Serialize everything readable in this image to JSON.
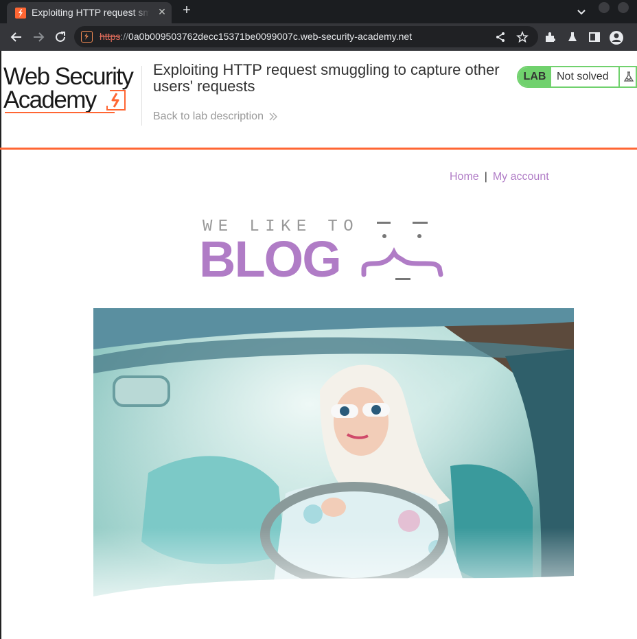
{
  "browser": {
    "tab_title": "Exploiting HTTP request smuggling to capture other users' requests",
    "tab_close": "✕",
    "new_tab": "+",
    "url_scheme": "https",
    "url_sep": "://",
    "url_host": "0a0b009503762decc15371be0099007c.web-security-academy.net",
    "icons": [
      "back-icon",
      "forward-icon",
      "reload-icon",
      "site-info-icon",
      "share-icon",
      "star-icon",
      "extensions-icon",
      "labs-flask-icon",
      "side-panel-icon",
      "profile-icon",
      "tab-search-icon"
    ]
  },
  "header": {
    "logo_line1": "Web Security",
    "logo_line2": "Academy",
    "lab_title": "Exploiting HTTP request smuggling to capture other users' requests",
    "back_link": "Back to lab description",
    "lab_tag": "LAB",
    "lab_status": "Not solved"
  },
  "nav": {
    "home": "Home",
    "separator": "|",
    "my_account": "My account"
  },
  "banner": {
    "tagline": "WE LIKE TO",
    "word": "BLOG"
  },
  "colors": {
    "accent_orange": "#ff6633",
    "link_purple": "#b07cc6",
    "lab_green": "#70d16d"
  }
}
